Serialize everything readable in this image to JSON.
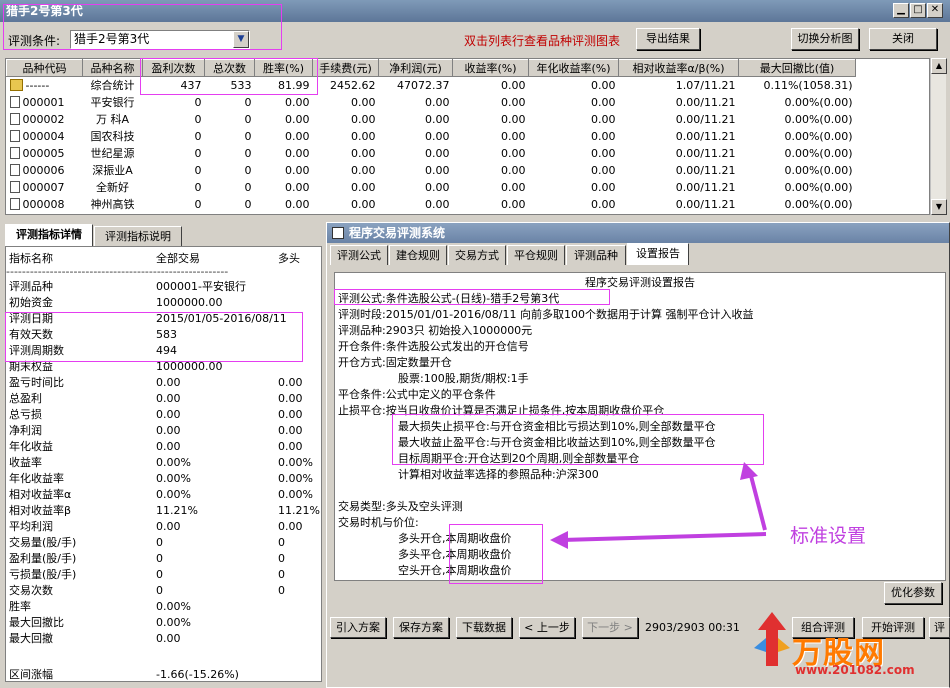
{
  "window": {
    "title": "猎手2号第3代"
  },
  "toolbar": {
    "condition_label": "评测条件:",
    "condition_value": "猎手2号第3代",
    "hint_text": "双击列表行查看品种评测图表",
    "export_button": "导出结果",
    "switch_button": "切换分析图",
    "close_button": "关闭"
  },
  "table": {
    "headers": [
      "品种代码",
      "品种名称",
      "盈利次数",
      "总次数",
      "胜率(%)",
      "手续费(元)",
      "净利润(元)",
      "收益率(%)",
      "年化收益率(%)",
      "相对收益率α/β(%)",
      "最大回撤比(值)"
    ],
    "rows": [
      [
        "------",
        "综合统计",
        "437",
        "533",
        "81.99",
        "2452.62",
        "47072.37",
        "0.00",
        "0.00",
        "1.07/11.21",
        "0.11%(1058.31)"
      ],
      [
        "000001",
        "平安银行",
        "0",
        "0",
        "0.00",
        "0.00",
        "0.00",
        "0.00",
        "0.00",
        "0.00/11.21",
        "0.00%(0.00)"
      ],
      [
        "000002",
        "万 科A",
        "0",
        "0",
        "0.00",
        "0.00",
        "0.00",
        "0.00",
        "0.00",
        "0.00/11.21",
        "0.00%(0.00)"
      ],
      [
        "000004",
        "国农科技",
        "0",
        "0",
        "0.00",
        "0.00",
        "0.00",
        "0.00",
        "0.00",
        "0.00/11.21",
        "0.00%(0.00)"
      ],
      [
        "000005",
        "世纪星源",
        "0",
        "0",
        "0.00",
        "0.00",
        "0.00",
        "0.00",
        "0.00",
        "0.00/11.21",
        "0.00%(0.00)"
      ],
      [
        "000006",
        "深振业A",
        "0",
        "0",
        "0.00",
        "0.00",
        "0.00",
        "0.00",
        "0.00",
        "0.00/11.21",
        "0.00%(0.00)"
      ],
      [
        "000007",
        "全新好",
        "0",
        "0",
        "0.00",
        "0.00",
        "0.00",
        "0.00",
        "0.00",
        "0.00/11.21",
        "0.00%(0.00)"
      ],
      [
        "000008",
        "神州高铁",
        "0",
        "0",
        "0.00",
        "0.00",
        "0.00",
        "0.00",
        "0.00",
        "0.00/11.21",
        "0.00%(0.00)"
      ]
    ]
  },
  "left_tabs": [
    "评测指标详情",
    "评测指标说明"
  ],
  "left_panel": {
    "headers": [
      "指标名称",
      "全部交易",
      "多头"
    ],
    "separator": "--------------------------------------------------------",
    "rows": [
      [
        "评测品种",
        "000001-平安银行",
        ""
      ],
      [
        "初始资金",
        "1000000.00",
        ""
      ],
      [
        "评测日期",
        "2015/01/05-2016/08/11",
        ""
      ],
      [
        "有效天数",
        "583",
        ""
      ],
      [
        "评测周期数",
        "494",
        ""
      ],
      [
        "期末权益",
        "1000000.00",
        ""
      ],
      [
        "盈亏时间比",
        "0.00",
        "0.00"
      ],
      [
        "总盈利",
        "0.00",
        "0.00"
      ],
      [
        "总亏损",
        "0.00",
        "0.00"
      ],
      [
        "净利润",
        "0.00",
        "0.00"
      ],
      [
        "年化收益",
        "0.00",
        "0.00"
      ],
      [
        "收益率",
        "0.00%",
        "0.00%"
      ],
      [
        "年化收益率",
        "0.00%",
        "0.00%"
      ],
      [
        "相对收益率α",
        "0.00%",
        "0.00%"
      ],
      [
        "相对收益率β",
        "11.21%",
        "11.21%"
      ],
      [
        "平均利润",
        "0.00",
        "0.00"
      ],
      [
        "交易量(股/手)",
        "0",
        "0"
      ],
      [
        "盈利量(股/手)",
        "0",
        "0"
      ],
      [
        "亏损量(股/手)",
        "0",
        "0"
      ],
      [
        "交易次数",
        "0",
        "0"
      ],
      [
        "胜率",
        "0.00%",
        ""
      ],
      [
        "最大回撤比",
        "0.00%",
        ""
      ],
      [
        "最大回撤",
        "0.00",
        ""
      ]
    ],
    "last_row": [
      "区间涨幅",
      "-1.66(-15.26%)",
      ""
    ]
  },
  "sub_window": {
    "title": "程序交易评测系统",
    "tabs": [
      "评测公式",
      "建仓规则",
      "交易方式",
      "平仓规则",
      "评测品种",
      "设置报告"
    ],
    "report_title": "程序交易评测设置报告",
    "report_lines": [
      "评测公式:条件选股公式-(日线)-猎手2号第3代",
      "评测时段:2015/01/01-2016/08/11 向前多取100个数据用于计算 强制平仓计入收益",
      "评测品种:2903只 初始投入1000000元",
      "开仓条件:条件选股公式发出的开仓信号",
      "开仓方式:固定数量开仓",
      "股票:100股,期货/期权:1手",
      "平仓条件:公式中定义的平仓条件",
      "止损平仓:按当日收盘价计算是否满足止损条件,按本周期收盘价平仓",
      "最大损失止损平仓:与开仓资金相比亏损达到10%,则全部数量平仓",
      "最大收益止盈平仓:与开仓资金相比收益达到10%,则全部数量平仓",
      "目标周期平仓:开仓达到20个周期,则全部数量平仓",
      "计算相对收益率选择的参照品种:沪深300",
      "交易类型:多头及空头评测",
      "交易时机与价位:",
      "多头开仓,本周期收盘价",
      "多头平仓,本周期收盘价",
      "空头开仓,本周期收盘价"
    ],
    "annotation": "标准设置",
    "optimize_button": "优化参数",
    "bottom_buttons": [
      "引入方案",
      "保存方案",
      "下载数据",
      "< 上一步",
      "下一步 >"
    ],
    "status": "2903/2903 00:31",
    "right_buttons": [
      "组合评测",
      "开始评测",
      "评测"
    ]
  },
  "watermark": {
    "brand": "万股网",
    "url": "www.201082.com"
  },
  "colors": {
    "highlight": "#e43ef0",
    "hint": "#c00000",
    "annotation": "#c040e0"
  }
}
